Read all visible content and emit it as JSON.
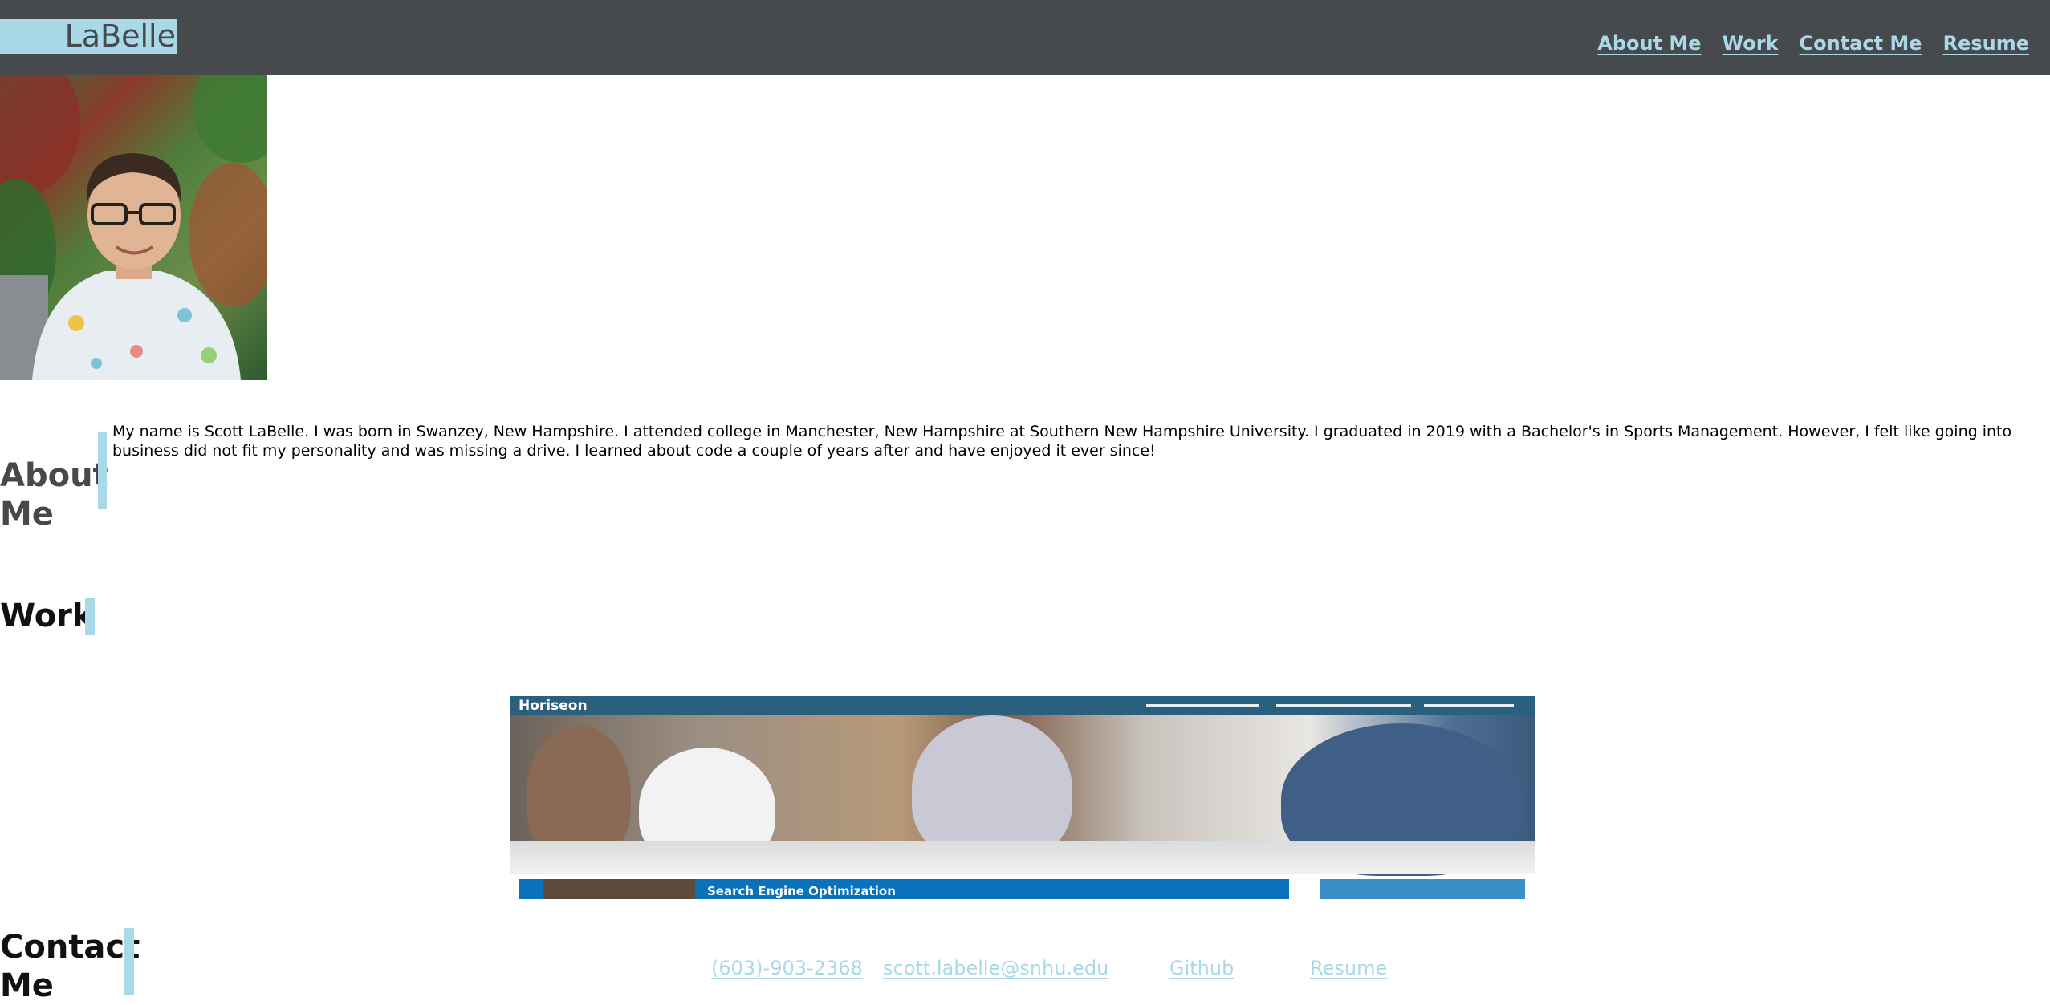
{
  "header": {
    "logo": "LaBelle",
    "nav": [
      {
        "label": "About Me"
      },
      {
        "label": "Work"
      },
      {
        "label": "Contact Me"
      },
      {
        "label": "Resume"
      }
    ]
  },
  "about": {
    "heading": "About Me",
    "body": "My name is Scott LaBelle. I was born in Swanzey, New Hampshire. I attended college in Manchester, New Hampshire at Southern New Hampshire University. I graduated in 2019 with a Bachelor's in Sports Management. However, I felt like going into business did not fit my personality and was missing a drive. I learned about code a couple of years after and have enjoyed it ever since!"
  },
  "work": {
    "heading": "Work",
    "screenshot": {
      "brand": "Horiseon",
      "banner_title": "Search Engine Optimization"
    }
  },
  "contact": {
    "heading": "Contact Me",
    "links": [
      {
        "label": "(603)-903-2368"
      },
      {
        "label": "scott.labelle@snhu.edu"
      },
      {
        "label": "Github"
      },
      {
        "label": "Resume"
      }
    ]
  },
  "colors": {
    "header_bg": "#474a4d",
    "accent": "#a9d8e7",
    "page_bg": "#ffffff"
  }
}
